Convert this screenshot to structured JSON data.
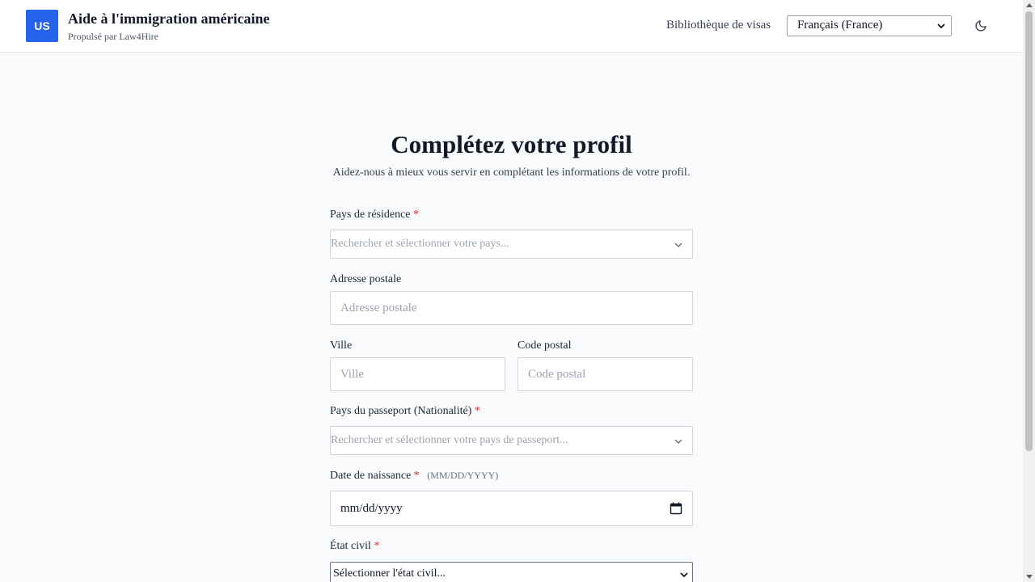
{
  "header": {
    "logo_text": "US",
    "title": "Aide à l'immigration américaine",
    "subtitle": "Propulsé par Law4Hire",
    "nav_visa_library": "Bibliothèque de visas",
    "language_selected": "Français (France)",
    "theme_icon": "moon-icon"
  },
  "main": {
    "title": "Complétez votre profil",
    "subtitle": "Aidez-nous à mieux vous servir en complétant les informations de votre profil."
  },
  "form": {
    "required_marker": "*",
    "residence_country": {
      "label": "Pays de résidence",
      "placeholder": "Rechercher et sélectionner votre pays..."
    },
    "postal_address": {
      "label": "Adresse postale",
      "placeholder": "Adresse postale"
    },
    "city": {
      "label": "Ville",
      "placeholder": "Ville"
    },
    "postal_code": {
      "label": "Code postal",
      "placeholder": "Code postal"
    },
    "passport_country": {
      "label": "Pays du passeport (Nationalité)",
      "placeholder": "Rechercher et sélectionner votre pays de passeport..."
    },
    "birth_date": {
      "label": "Date de naissance",
      "hint": "(MM/DD/YYYY)",
      "value": "mm/dd/yyyy"
    },
    "marital_status": {
      "label": "État civil",
      "selected": "Sélectionner l'état civil..."
    }
  },
  "colors": {
    "brand": "#2563eb",
    "required": "#dc2626",
    "background": "#f9fafb"
  }
}
